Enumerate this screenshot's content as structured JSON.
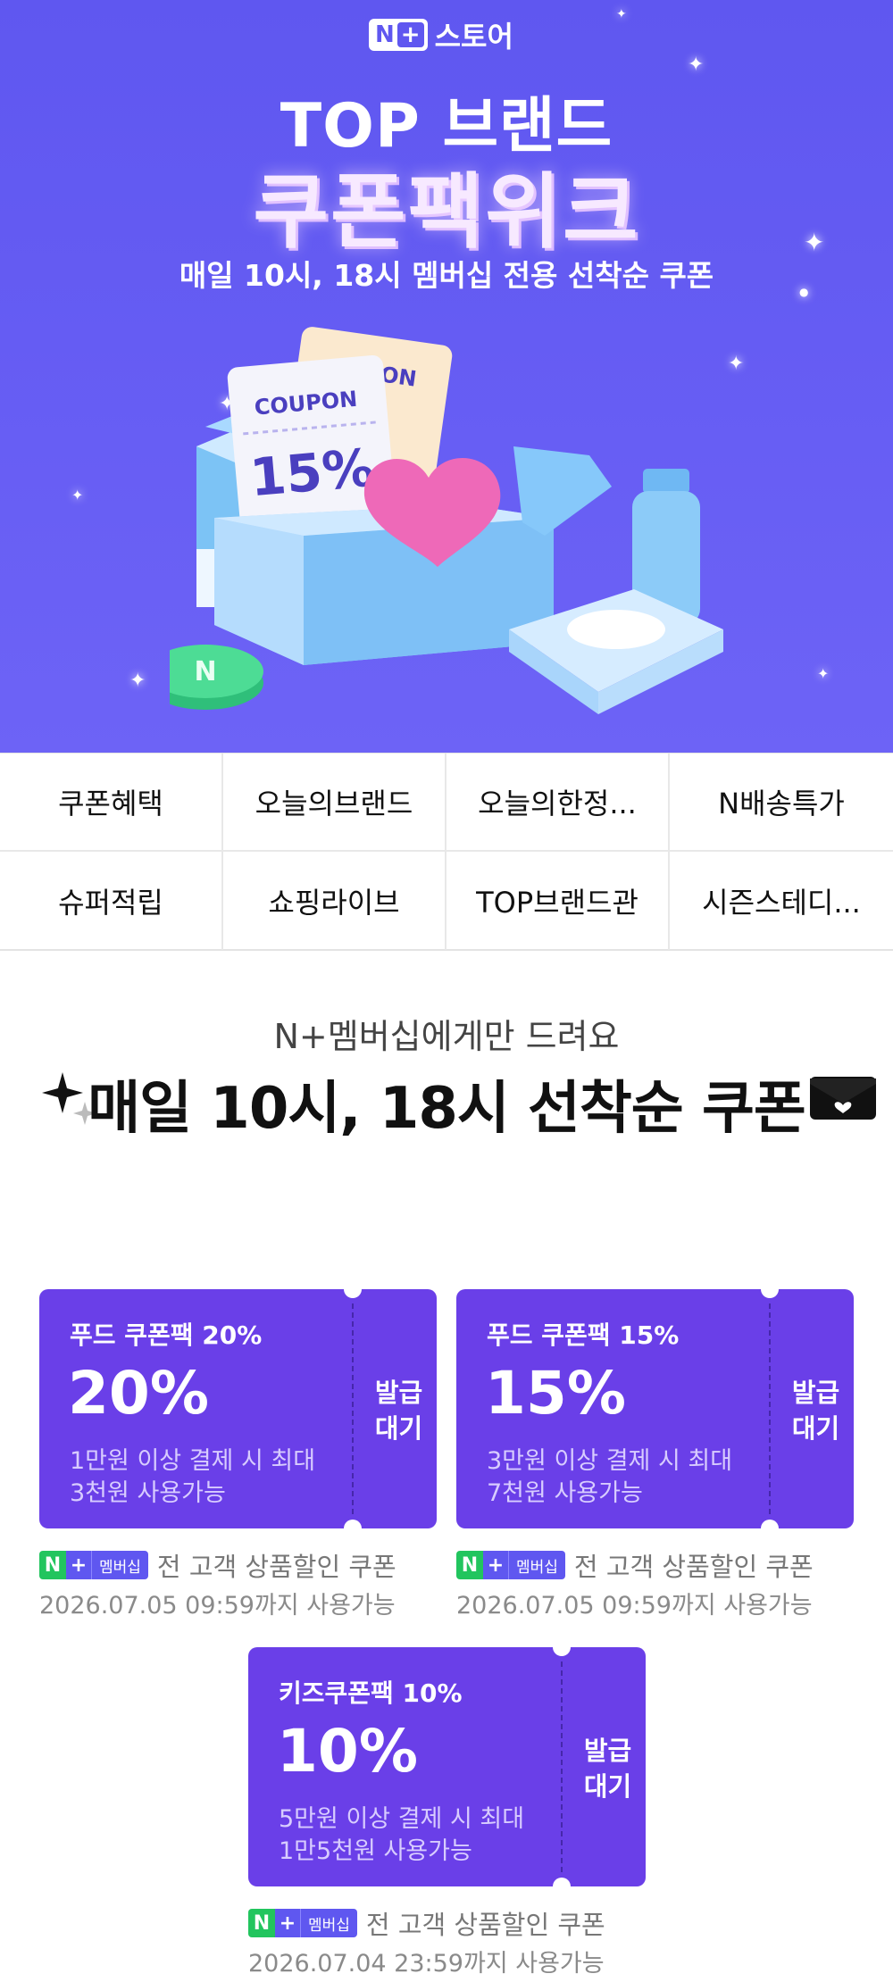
{
  "hero": {
    "logo_n": "N",
    "logo_plus": "+",
    "logo_text": "스토어",
    "title1": "TOP 브랜드",
    "title2": "쿠폰팩위크",
    "subtitle": "매일 10시, 18시 멤버십 전용 선착순 쿠폰",
    "art": {
      "coupon_front_label": "COUPON",
      "coupon_front_value": "15%",
      "coupon_back_label": "OUPON"
    }
  },
  "menu": {
    "items": [
      {
        "label": "쿠폰혜택"
      },
      {
        "label": "오늘의브랜드"
      },
      {
        "label": "오늘의한정..."
      },
      {
        "label": "N배송특가"
      },
      {
        "label": "슈퍼적립"
      },
      {
        "label": "쇼핑라이브"
      },
      {
        "label": "TOP브랜드관"
      },
      {
        "label": "시즌스테디..."
      }
    ]
  },
  "promo": {
    "subtitle": "N+멤버십에게만 드려요",
    "title": "매일 10시, 18시 선착순 쿠폰"
  },
  "coupons": [
    {
      "name": "푸드 쿠폰팩 20%",
      "percent": "20%",
      "cond1": "1만원 이상 결제 시 최대",
      "cond2": "3천원 사용가능",
      "status": "발급\n대기",
      "desc": "전 고객 상품할인 쿠폰",
      "expiry": "2026.07.05 09:59까지 사용가능"
    },
    {
      "name": "푸드 쿠폰팩 15%",
      "percent": "15%",
      "cond1": "3만원 이상 결제 시 최대",
      "cond2": "7천원 사용가능",
      "status": "발급\n대기",
      "desc": "전 고객 상품할인 쿠폰",
      "expiry": "2026.07.05 09:59까지 사용가능"
    },
    {
      "name": "키즈쿠폰팩 10%",
      "percent": "10%",
      "cond1": "5만원 이상 결제 시 최대",
      "cond2": "1만5천원 사용가능",
      "status": "발급\n대기",
      "desc": "전 고객 상품할인 쿠폰",
      "expiry": "2026.07.04 23:59까지 사용가능"
    }
  ],
  "badge": {
    "n": "N",
    "plus": "+",
    "membership": "멤버십"
  },
  "colors": {
    "hero_bg": "#655cf3",
    "coupon_bg": "#6a3fe8",
    "badge_green": "#22c55e",
    "badge_purple": "#5f57f0"
  }
}
